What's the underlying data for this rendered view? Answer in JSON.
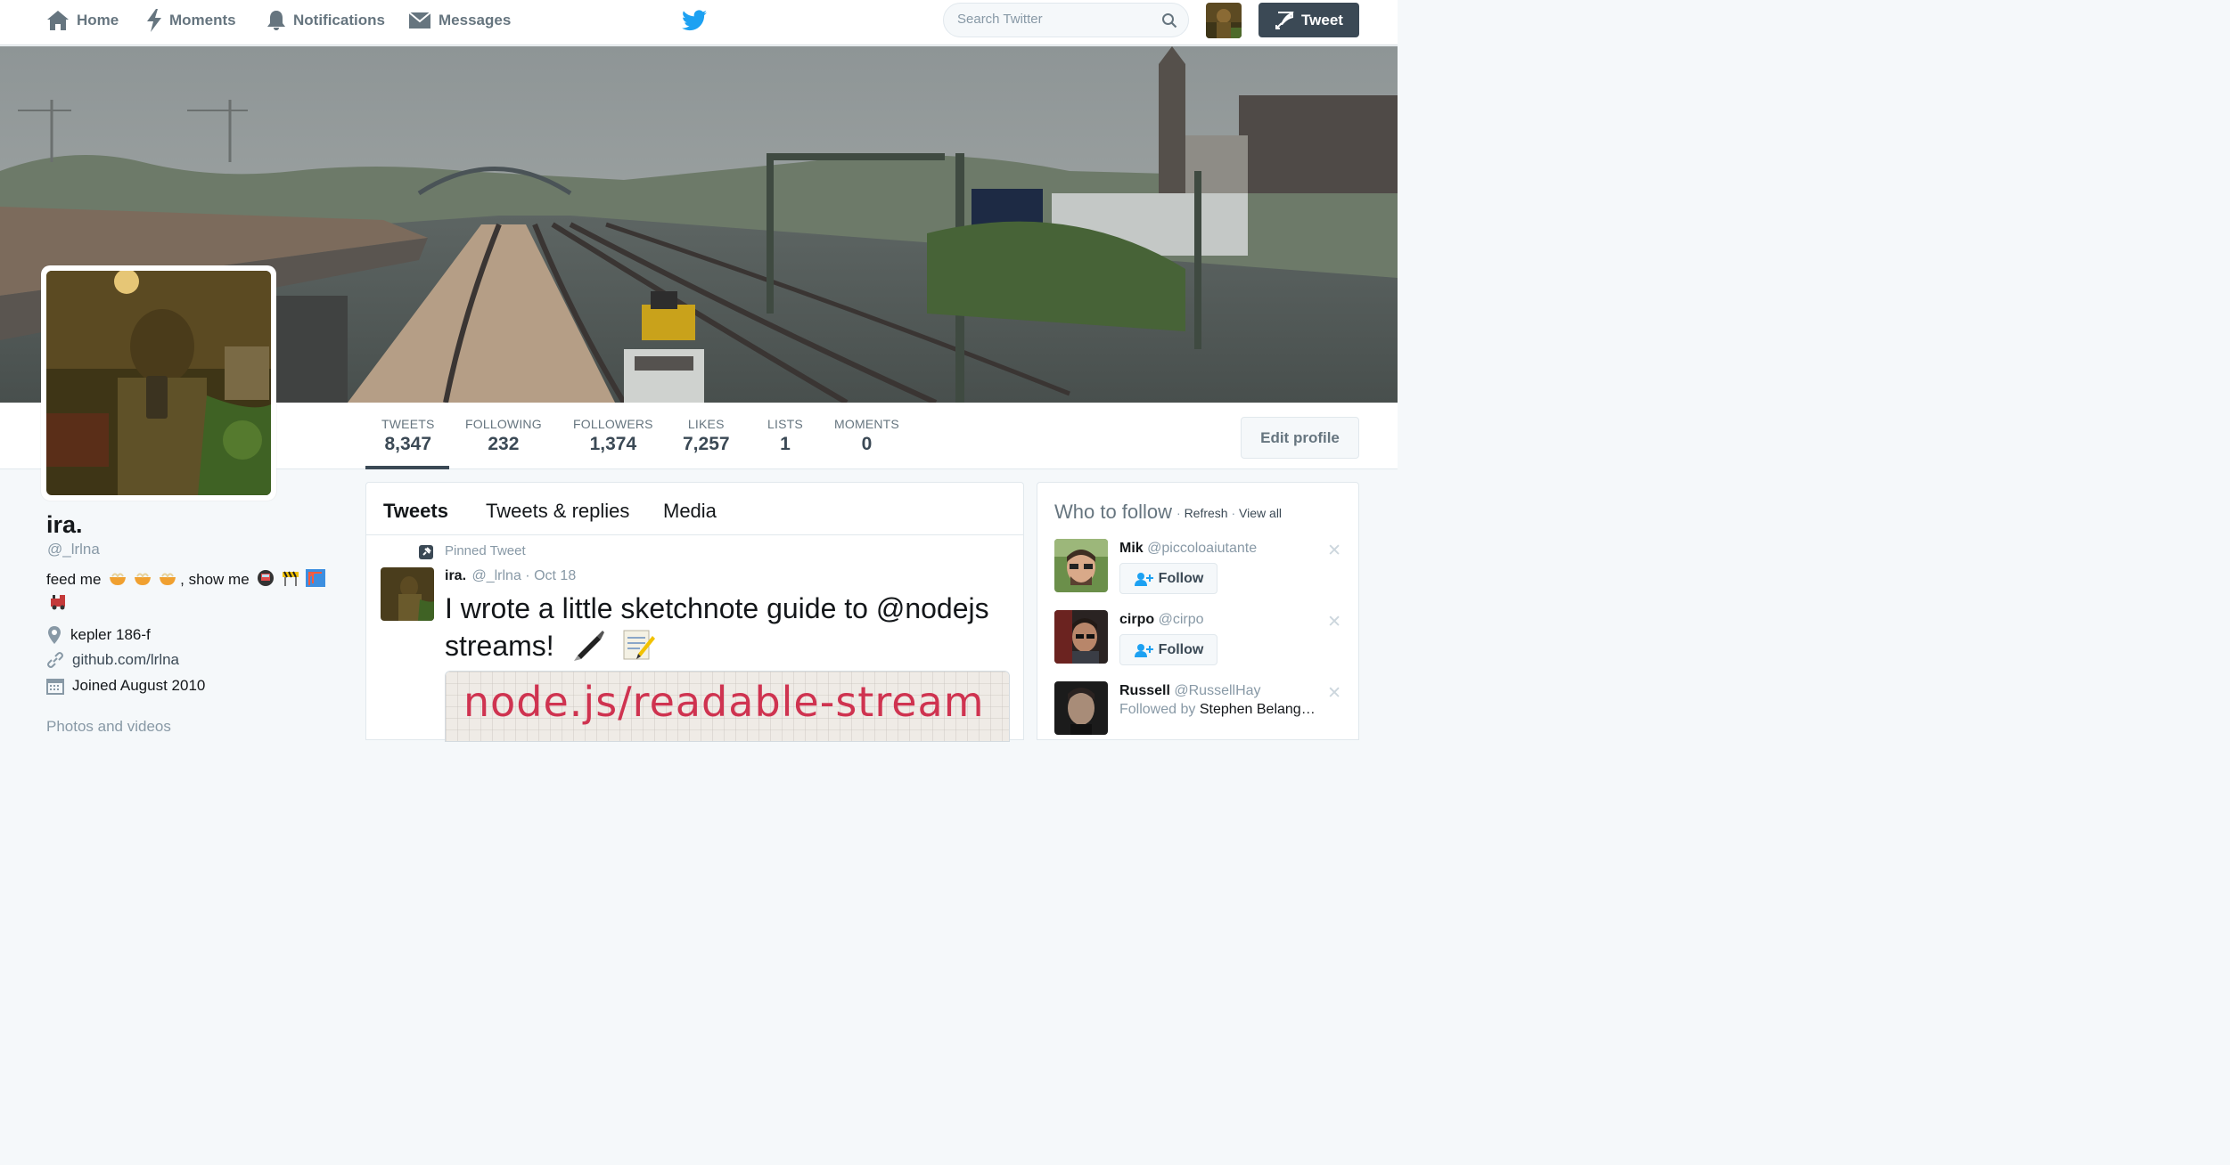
{
  "nav": {
    "home": "Home",
    "moments": "Moments",
    "notifications": "Notifications",
    "messages": "Messages",
    "search_placeholder": "Search Twitter",
    "tweet_button": "Tweet",
    "logo_icon": "twitter-bird-icon"
  },
  "colors": {
    "accent": "#3b4955",
    "twitter_blue": "#1da1f2",
    "muted": "#8899a6"
  },
  "stats": [
    {
      "label": "TWEETS",
      "value": "8,347"
    },
    {
      "label": "FOLLOWING",
      "value": "232"
    },
    {
      "label": "FOLLOWERS",
      "value": "1,374"
    },
    {
      "label": "LIKES",
      "value": "7,257"
    },
    {
      "label": "LISTS",
      "value": "1"
    },
    {
      "label": "MOMENTS",
      "value": "0"
    }
  ],
  "edit_profile": "Edit profile",
  "profile": {
    "name": "ira.",
    "handle": "@_lrlna",
    "bio_part1": "feed me",
    "bio_part2": ", show me",
    "location": "kepler 186-f",
    "website": "github.com/lrlna",
    "joined": "Joined August 2010",
    "photos": "Photos and videos"
  },
  "timeline": {
    "tabs": [
      "Tweets",
      "Tweets & replies",
      "Media"
    ],
    "pinned_label": "Pinned Tweet",
    "tweet": {
      "name": "ira.",
      "handle": "@_lrlna",
      "date": "Oct 18",
      "text": "I wrote a little sketchnote guide to @nodejs streams!",
      "media_text": "node.js/readable-stream"
    }
  },
  "who_to_follow": {
    "title": "Who to follow",
    "refresh": "Refresh",
    "view_all": "View all",
    "follow_label": "Follow",
    "suggestions": [
      {
        "name": "Mik",
        "handle": "@piccoloaiutante"
      },
      {
        "name": "cirpo",
        "handle": "@cirpo"
      },
      {
        "name": "Russell",
        "handle": "@RussellHay",
        "followed_by": "Followed by",
        "followed_by_name": "Stephen Belang…"
      }
    ]
  }
}
